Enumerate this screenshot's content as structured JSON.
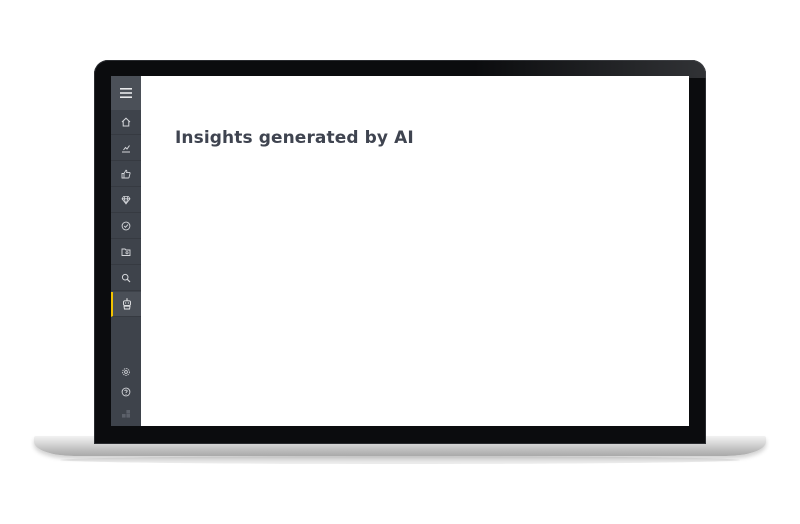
{
  "window": {
    "type": "laptop-mockup"
  },
  "sidebar": {
    "menu_icon": "hamburger-menu-icon",
    "items": [
      {
        "icon": "home-icon",
        "active": false
      },
      {
        "icon": "chart-icon",
        "active": false
      },
      {
        "icon": "thumbs-up-icon",
        "active": false
      },
      {
        "icon": "diamond-icon",
        "active": false
      },
      {
        "icon": "check-circle-icon",
        "active": false
      },
      {
        "icon": "folder-search-icon",
        "active": false
      },
      {
        "icon": "search-icon",
        "active": false
      },
      {
        "icon": "robot-icon",
        "active": true
      }
    ],
    "bottom_items": [
      {
        "icon": "gear-icon"
      },
      {
        "icon": "help-icon"
      },
      {
        "icon": "logo-icon"
      }
    ]
  },
  "main": {
    "title": "Insights generated by AI"
  },
  "colors": {
    "sidebar_bg": "#3e434b",
    "active_accent": "#f2c200",
    "title_text": "#3f4450",
    "bezel": "#0b0c0e"
  }
}
